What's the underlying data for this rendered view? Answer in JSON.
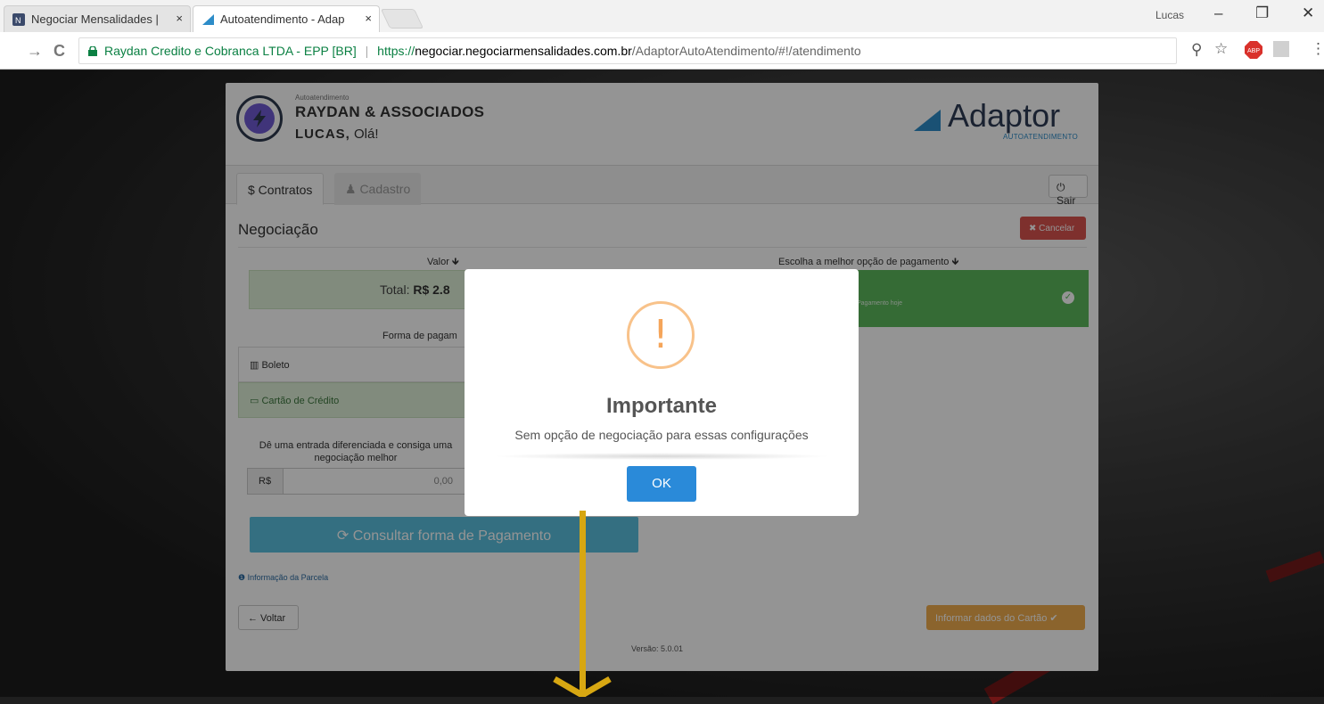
{
  "browser": {
    "tabs": [
      {
        "title": "Negociar Mensalidades |",
        "close": "×"
      },
      {
        "title": "Autoatendimento - Adap",
        "close": "×"
      }
    ],
    "profile": "Lucas",
    "window_controls": {
      "minimize": "–",
      "maximize": "❐",
      "close": "✕"
    },
    "nav": {
      "back": "←",
      "forward": "→",
      "reload": "C"
    },
    "address": {
      "secure_label": "Raydan Credito e Cobranca LTDA - EPP [BR]",
      "separator": "|",
      "scheme": "https://",
      "host": "negociar.negociarmensalidades.com.br",
      "path": "/AdaptorAutoAtendimento/#!/atendimento"
    }
  },
  "header": {
    "small_label": "Autoatendimento",
    "company": "RAYDAN & ASSOCIADOS",
    "user_name": "LUCAS,",
    "greeting": " Olá!",
    "brand": "Adaptor",
    "brand_sub": "AUTOATENDIMENTO"
  },
  "tabs": {
    "contratos": "$ Contratos",
    "cadastro": "♟ Cadastro",
    "sair": "⏻ Sair"
  },
  "negociacao": {
    "title": "Negociação",
    "cancel": "✖ Cancelar",
    "valor_label": "Valor 🡻",
    "total_prefix": "Total: ",
    "total_value": "R$ 2.8",
    "opcao_label": "Escolha a melhor opção de pagamento 🡻",
    "opcao_sub": "Pagamento hoje",
    "forma_label": "Forma de pagam",
    "boleto": "▥ Boleto",
    "cartao": "▭ Cartão de Crédito",
    "entrada_text": "Dê uma entrada diferenciada e consiga uma negociação melhor",
    "rs_addon": "R$",
    "rs_value": "0,00",
    "consultar": "⟳ Consultar forma de Pagamento",
    "info_parcela": "❶ Informação da Parcela",
    "voltar": "← Voltar",
    "informar": "Informar dados do Cartão ✔",
    "versao": "Versão: 5.0.01"
  },
  "modal": {
    "icon": "!",
    "title": "Importante",
    "text": "Sem opção de negociação para essas configurações",
    "ok": "OK"
  },
  "colors": {
    "success": "#5cb85c",
    "danger": "#d9534f",
    "info": "#5bc0de",
    "warning": "#f0ad4e",
    "primary": "#2a8ad9",
    "annotation_arrow": "#d7a712"
  }
}
